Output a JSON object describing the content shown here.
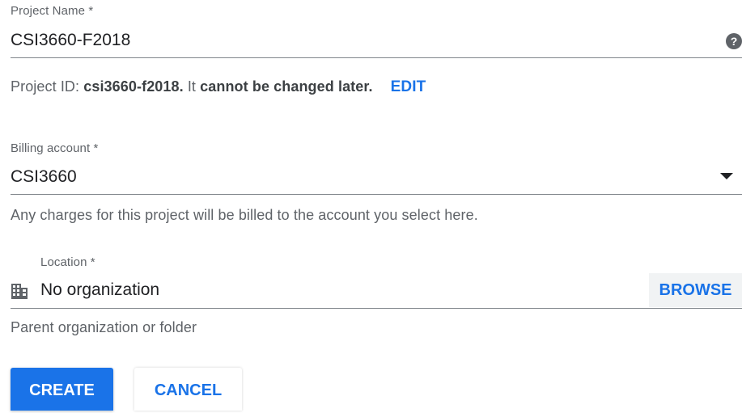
{
  "project_name": {
    "label": "Project Name *",
    "value": "CSI3660-F2018",
    "help_icon": "help-circle-icon"
  },
  "project_id": {
    "prefix": "Project ID: ",
    "id": "csi3660-f2018.",
    "middle": " It ",
    "suffix": "cannot be changed later.",
    "edit_label": "EDIT"
  },
  "billing": {
    "label": "Billing account *",
    "value": "CSI3660",
    "arrow_icon": "dropdown-arrow-icon",
    "helper": "Any charges for this project will be billed to the account you select here."
  },
  "location": {
    "label": "Location *",
    "icon": "building-icon",
    "value": "No organization",
    "browse_label": "BROWSE",
    "helper": "Parent organization or folder"
  },
  "actions": {
    "create_label": "CREATE",
    "cancel_label": "CANCEL"
  },
  "colors": {
    "accent": "#1a73e8",
    "text_primary": "#202124",
    "text_secondary": "#5f6368",
    "underline": "#80868b",
    "browse_bg": "#f1f3f4"
  }
}
